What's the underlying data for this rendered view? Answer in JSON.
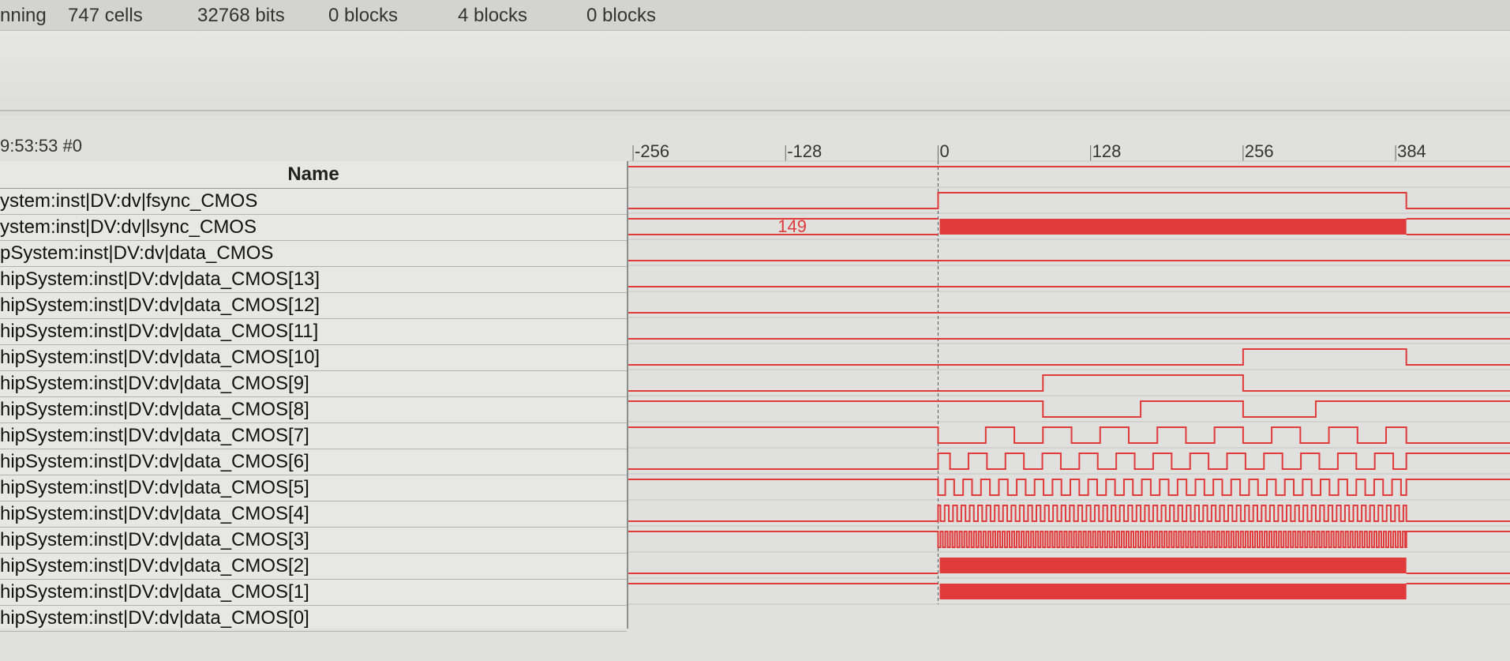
{
  "status": {
    "items": [
      "nning",
      "747 cells",
      "32768 bits",
      "0 blocks",
      "4 blocks",
      "0 blocks"
    ]
  },
  "panel": {
    "time_label": "9:53:53  #0"
  },
  "names": {
    "header": "Name",
    "signals": [
      "ystem:inst|DV:dv|fsync_CMOS",
      "ystem:inst|DV:dv|lsync_CMOS",
      "pSystem:inst|DV:dv|data_CMOS",
      "hipSystem:inst|DV:dv|data_CMOS[13]",
      "hipSystem:inst|DV:dv|data_CMOS[12]",
      "hipSystem:inst|DV:dv|data_CMOS[11]",
      "hipSystem:inst|DV:dv|data_CMOS[10]",
      "hipSystem:inst|DV:dv|data_CMOS[9]",
      "hipSystem:inst|DV:dv|data_CMOS[8]",
      "hipSystem:inst|DV:dv|data_CMOS[7]",
      "hipSystem:inst|DV:dv|data_CMOS[6]",
      "hipSystem:inst|DV:dv|data_CMOS[5]",
      "hipSystem:inst|DV:dv|data_CMOS[4]",
      "hipSystem:inst|DV:dv|data_CMOS[3]",
      "hipSystem:inst|DV:dv|data_CMOS[2]",
      "hipSystem:inst|DV:dv|data_CMOS[1]",
      "hipSystem:inst|DV:dv|data_CMOS[0]"
    ]
  },
  "timeline": {
    "ticks": [
      -256,
      -128,
      0,
      128,
      256,
      384
    ],
    "tick_labels": [
      "-256",
      "-128",
      "0",
      "128",
      "256",
      "384"
    ],
    "bus_value_label": "149",
    "bus_value_time": -128
  },
  "waves": {
    "color": "#e03a3a",
    "range": [
      -260,
      480
    ],
    "data_end": 393,
    "fsync": {
      "level": 1
    },
    "lsync": {
      "low_until": 0,
      "high_until": 393
    },
    "bits": [
      {
        "bit": 13,
        "mode": "const",
        "level": 0
      },
      {
        "bit": 12,
        "mode": "const",
        "level": 0
      },
      {
        "bit": 11,
        "mode": "const",
        "level": 0
      },
      {
        "bit": 10,
        "mode": "const",
        "level": 0
      },
      {
        "bit": 9,
        "mode": "edges",
        "initial": 0,
        "edges": [
          256,
          393
        ]
      },
      {
        "bit": 8,
        "mode": "edges",
        "initial": 0,
        "edges": [
          88,
          256
        ]
      },
      {
        "bit": 7,
        "mode": "edges",
        "initial": 1,
        "edges": [
          88,
          170,
          256,
          317
        ]
      },
      {
        "bit": 6,
        "mode": "clock",
        "initial": 1,
        "start": 40,
        "period": 48
      },
      {
        "bit": 5,
        "mode": "clock",
        "initial": 0,
        "start": 10,
        "period": 31
      },
      {
        "bit": 4,
        "mode": "clock",
        "initial": 1,
        "start": 6,
        "period": 15
      },
      {
        "bit": 3,
        "mode": "clock",
        "initial": 0,
        "start": 2,
        "period": 7
      },
      {
        "bit": 2,
        "mode": "clock",
        "initial": 1,
        "start": 2,
        "period": 4
      },
      {
        "bit": 1,
        "mode": "dense",
        "initial": 0
      },
      {
        "bit": 0,
        "mode": "dense",
        "initial": 1
      }
    ]
  }
}
